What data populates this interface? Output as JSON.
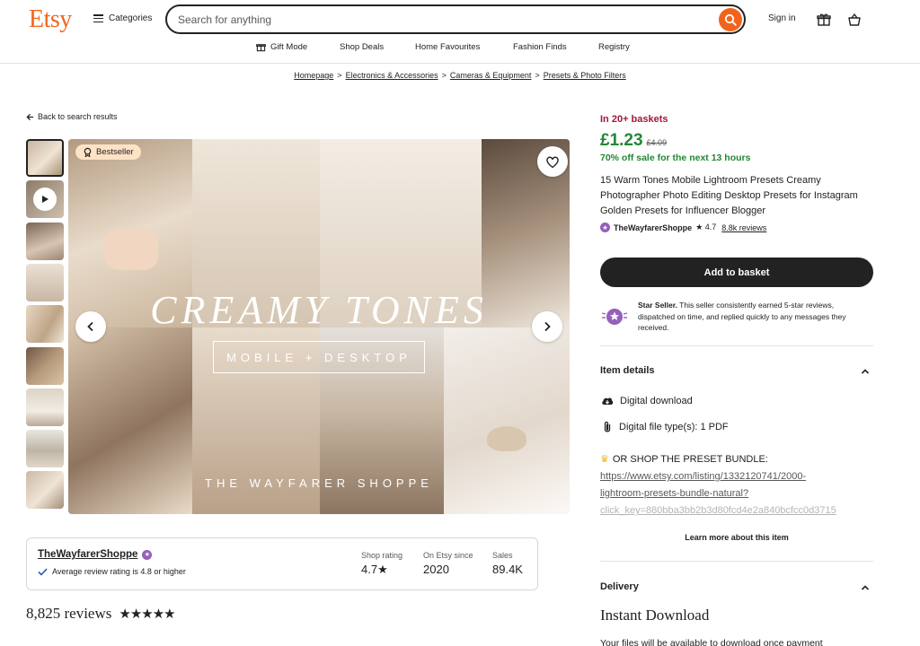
{
  "header": {
    "logo": "Etsy",
    "categories": "Categories",
    "search_placeholder": "Search for anything",
    "signin": "Sign in"
  },
  "nav": [
    "Gift Mode",
    "Shop Deals",
    "Home Favourites",
    "Fashion Finds",
    "Registry"
  ],
  "breadcrumb": [
    "Homepage",
    "Electronics & Accessories",
    "Cameras & Equipment",
    "Presets & Photo Filters"
  ],
  "back": "Back to search results",
  "gallery": {
    "badge": "Bestseller",
    "title": "CREAMY TONES",
    "subtitle": "MOBILE + DESKTOP",
    "brand": "THE WAYFARER SHOPPE"
  },
  "shop": {
    "name": "TheWayfarerShoppe",
    "review_note": "Average review rating is 4.8 or higher",
    "stats": [
      {
        "label": "Shop rating",
        "value": "4.7★"
      },
      {
        "label": "On Etsy since",
        "value": "2020"
      },
      {
        "label": "Sales",
        "value": "89.4K"
      }
    ]
  },
  "reviews": {
    "count": "8,825 reviews",
    "stars": "★★★★★"
  },
  "product": {
    "baskets": "In 20+ baskets",
    "price": "£1.23",
    "old_price": "£4.09",
    "sale": "70% off sale for the next 13 hours",
    "title": "15 Warm Tones Mobile Lightroom Presets Creamy Photographer Photo Editing Desktop Presets for Instagram Golden Presets for Influencer Blogger",
    "seller": "TheWayfarerShoppe",
    "rating": "★ 4.7",
    "reviews_link": "8.8k reviews",
    "add_to_basket": "Add to basket"
  },
  "star_seller": {
    "bold": "Star Seller.",
    "text": " This seller consistently earned 5-star reviews, dispatched on time, and replied quickly to any messages they received."
  },
  "item_details": {
    "header": "Item details",
    "download": "Digital download",
    "filetype": "Digital file type(s): 1 PDF",
    "bundle_text": "OR SHOP THE PRESET BUNDLE:",
    "bundle_link_1": "https://www.etsy.com/listing/1332120741/2000-",
    "bundle_link_2": "lightroom-presets-bundle-natural?",
    "bundle_link_3": "click_key=880bba3bb2b3d80fcd4e2a840bcfcc0d3715",
    "learn_more": "Learn more about this item"
  },
  "delivery": {
    "header": "Delivery",
    "title": "Instant Download",
    "text": "Your files will be available to download once payment"
  }
}
